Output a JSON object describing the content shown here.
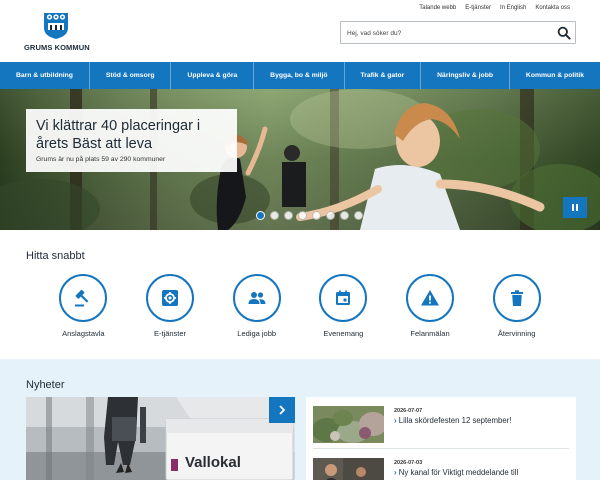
{
  "header": {
    "logo_text": "GRUMS KOMMUN",
    "top_links": [
      "Talande webb",
      "E-tjänster",
      "In English",
      "Kontakta oss"
    ],
    "search_placeholder": "Hej, vad söker du?"
  },
  "nav": {
    "items": [
      "Barn & utbildning",
      "Stöd & omsorg",
      "Uppleva & göra",
      "Bygga, bo & miljö",
      "Trafik & gator",
      "Näringsliv & jobb",
      "Kommun & politik"
    ]
  },
  "hero": {
    "title": "Vi klättrar 40 placeringar i årets Bäst att leva",
    "subtitle": "Grums är nu på plats 59 av 290 kommuner",
    "slide_count": 8,
    "active_slide": 1
  },
  "quick": {
    "title": "Hitta snabbt",
    "items": [
      {
        "label": "Anslagstavla",
        "icon": "gavel-icon"
      },
      {
        "label": "E-tjänster",
        "icon": "settings-box-icon"
      },
      {
        "label": "Lediga jobb",
        "icon": "people-icon"
      },
      {
        "label": "Evenemang",
        "icon": "calendar-icon"
      },
      {
        "label": "Felanmälan",
        "icon": "warning-icon"
      },
      {
        "label": "Återvinning",
        "icon": "trash-icon"
      }
    ]
  },
  "news": {
    "title": "Nyheter",
    "image_sign": "Vallokal",
    "items": [
      {
        "date": "2026-07-07",
        "headline": "Lilla skördefesten 12 september!"
      },
      {
        "date": "2026-07-03",
        "headline": "Ny kanal för Viktigt meddelande till"
      }
    ]
  },
  "colors": {
    "accent": "#1576c0",
    "news_bg": "#e6f2f9"
  }
}
